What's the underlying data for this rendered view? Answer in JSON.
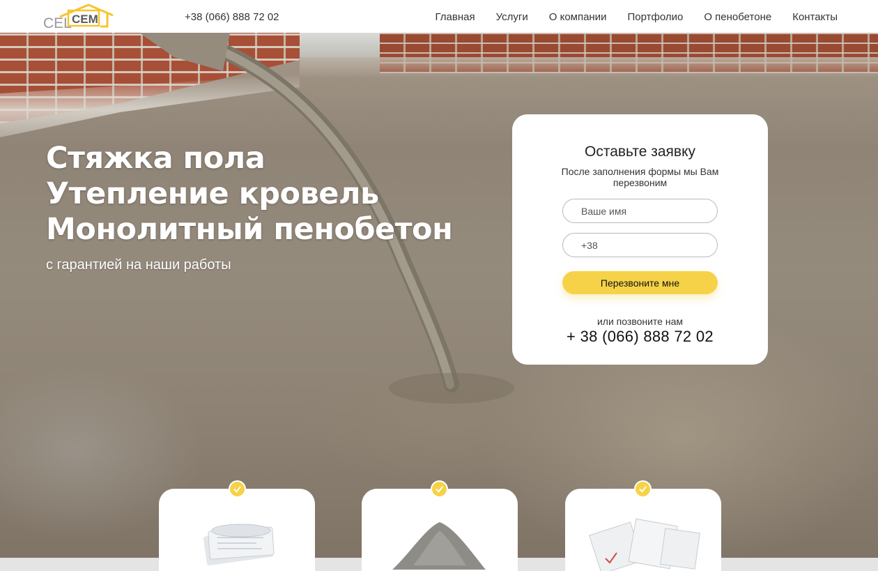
{
  "header": {
    "logo_text": "CELCEM",
    "phone": "+38 (066) 888 72 02",
    "nav": [
      {
        "label": "Главная"
      },
      {
        "label": "Услуги"
      },
      {
        "label": "О компании"
      },
      {
        "label": "Портфолио"
      },
      {
        "label": "О пенобетоне"
      },
      {
        "label": "Контакты"
      }
    ]
  },
  "hero": {
    "title_lines": [
      "Стяжка пола",
      "Утепление кровель",
      "Монолитный пенобетон"
    ],
    "subtitle": "с гарантией на наши работы"
  },
  "form": {
    "title": "Оставьте заявку",
    "description": "После заполнения формы мы Вам перезвоним",
    "name_placeholder": "Ваше имя",
    "phone_placeholder": "+38",
    "submit_label": "Перезвоните мне",
    "or_call": "или позвоните нам",
    "phone": "+ 38 (066) 888 72 02"
  },
  "features": [
    {
      "icon": "blueprints-icon"
    },
    {
      "icon": "cement-pile-icon"
    },
    {
      "icon": "certificates-icon"
    }
  ],
  "colors": {
    "accent": "#f6d248",
    "text": "#333333",
    "card": "#ffffff"
  }
}
